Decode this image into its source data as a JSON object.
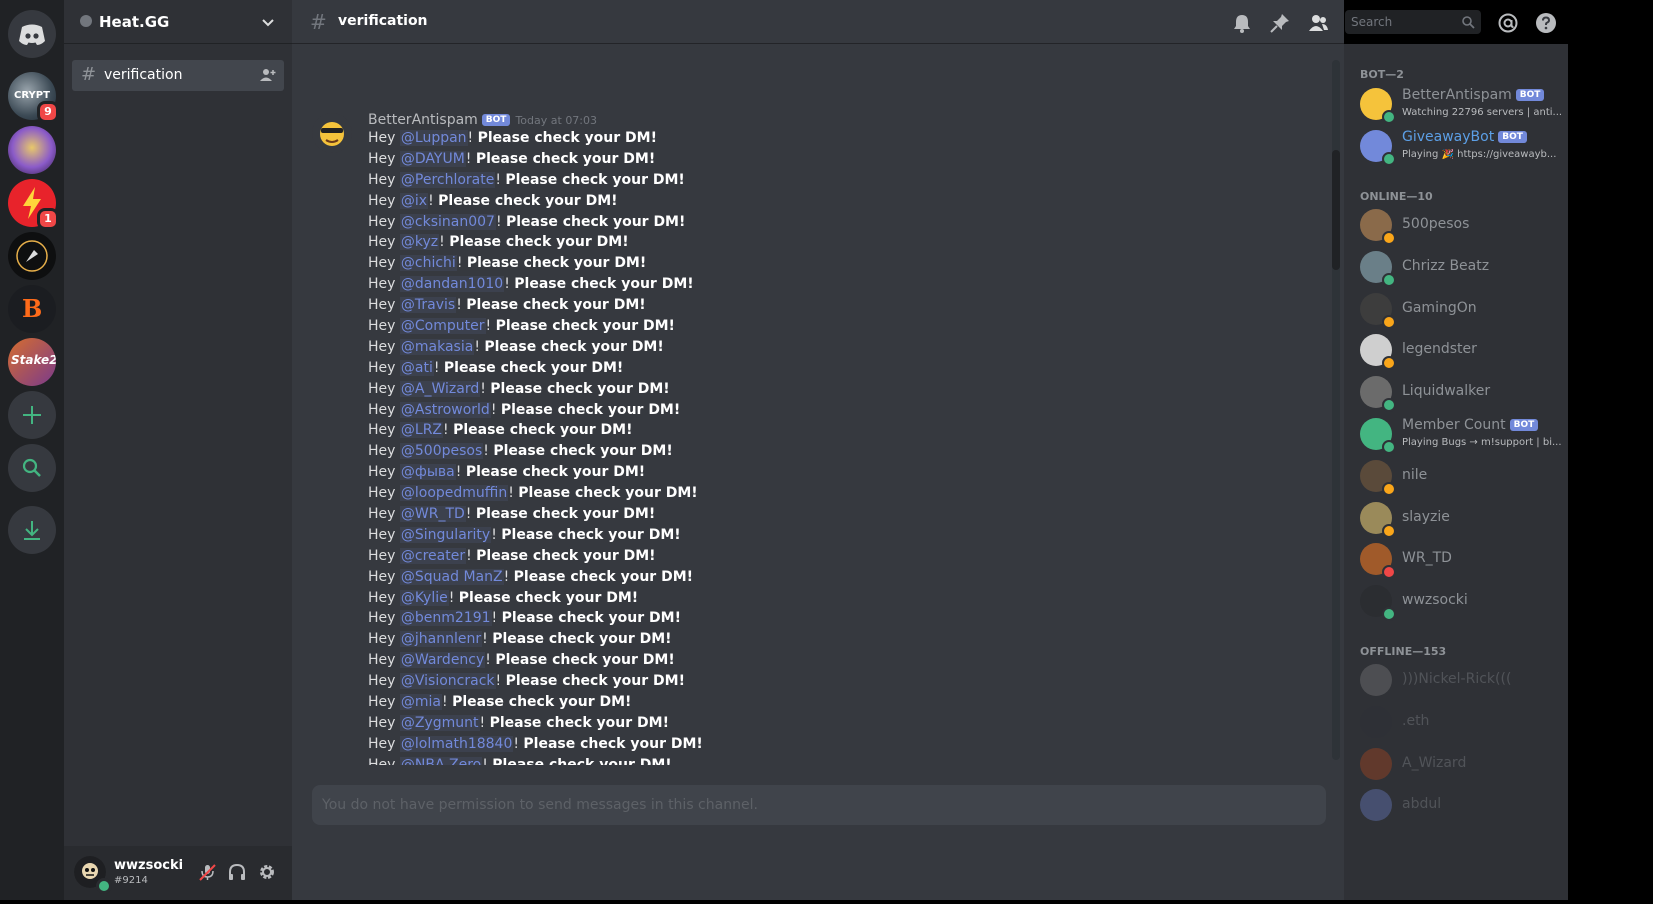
{
  "server": {
    "name": "Heat.GG"
  },
  "servers": [
    {
      "name": "CRYPTO",
      "badge": "9"
    },
    {
      "name": "emoji-server",
      "badge": ""
    },
    {
      "name": "lightning",
      "badge": "1"
    },
    {
      "name": "compass",
      "badge": ""
    },
    {
      "name": "B-server",
      "badge": ""
    },
    {
      "name": "Stake2",
      "badge": ""
    }
  ],
  "channel": {
    "name": "verification"
  },
  "user": {
    "name": "wwzsocki",
    "tag": "#9214"
  },
  "search": {
    "placeholder": "Search"
  },
  "message": {
    "author": "BetterAntispam",
    "bot_label": "BOT",
    "time": "Today at 07:03",
    "prefix": "Hey",
    "suffix": "Please check your DM!",
    "mentions": [
      "@Luppan",
      "@DAYUM",
      "@Perchlorate",
      "@ix",
      "@cksinan007",
      "@kyz",
      "@chichi",
      "@dandan1010",
      "@Travis",
      "@Computer",
      "@makasia",
      "@ati",
      "@A_Wizard",
      "@Astroworld",
      "@LRZ",
      "@500pesos",
      "@фыва",
      "@loopedmuffin",
      "@WR_TD",
      "@Singularity",
      "@creater",
      "@Squad ManZ",
      "@Kylie",
      "@benm2191",
      "@jhannlenr",
      "@Wardency",
      "@Visioncrack",
      "@mia",
      "@Zygmunt",
      "@lolmath18840",
      "@NBA Zero"
    ]
  },
  "input": {
    "placeholder": "You do not have permission to send messages in this channel."
  },
  "members": {
    "bot_header": "BOT—2",
    "bots": [
      {
        "name": "BetterAntispam",
        "badge": "BOT",
        "activity": "Watching 22796 servers | anti...",
        "name_color": "#8e9297"
      },
      {
        "name": "GiveawayBot",
        "badge": "BOT",
        "activity": "Playing 🎉 https://giveawayb...",
        "name_color": "#5c9fe6"
      }
    ],
    "online_header": "ONLINE—10",
    "online": [
      {
        "name": "500pesos",
        "status": "idle"
      },
      {
        "name": "Chrizz Beatz",
        "status": "online"
      },
      {
        "name": "GamingOn",
        "status": "idle"
      },
      {
        "name": "legendster",
        "status": "idle"
      },
      {
        "name": "Liquidwalker",
        "status": "online"
      },
      {
        "name": "Member Count",
        "badge": "BOT",
        "activity": "Playing Bugs → m!support | bi...",
        "status": "online"
      },
      {
        "name": "nile",
        "status": "idle"
      },
      {
        "name": "slayzie",
        "status": "idle"
      },
      {
        "name": "WR_TD",
        "status": "dnd"
      },
      {
        "name": "wwzsocki",
        "status": "online"
      }
    ],
    "offline_header": "OFFLINE—153",
    "offline": [
      {
        "name": ")))Nickel-Rick((("
      },
      {
        "name": ".eth"
      },
      {
        "name": "A_Wizard"
      },
      {
        "name": "abdul"
      }
    ]
  },
  "colors": {
    "accent": "#7289da",
    "online": "#43b581",
    "idle": "#faa61a",
    "dnd": "#f04747"
  }
}
